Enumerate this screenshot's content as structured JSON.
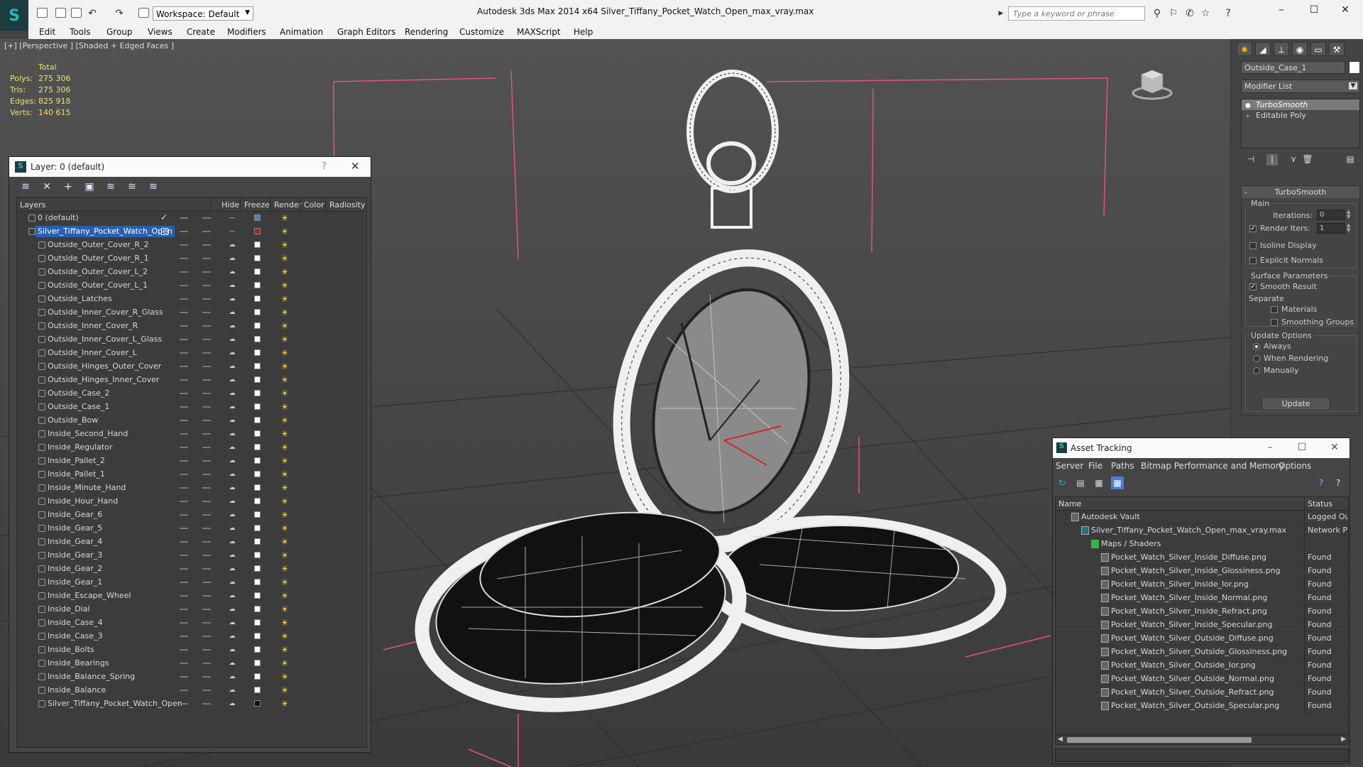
{
  "titlebar": {
    "workspace": "Workspace: Default",
    "window_title": "Autodesk 3ds Max  2014 x64      Silver_Tiffany_Pocket_Watch_Open_max_vray.max",
    "search_placeholder": "Type a keyword or phrase"
  },
  "menu": [
    "Edit",
    "Tools",
    "Group",
    "Views",
    "Create",
    "Modifiers",
    "Animation",
    "Graph Editors",
    "Rendering",
    "Customize",
    "MAXScript",
    "Help"
  ],
  "viewport": {
    "label": "[+] [Perspective ] [Shaded + Edged Faces ]",
    "stats": {
      "total_label": "Total",
      "rows": [
        {
          "label": "Polys:",
          "value": "275 306"
        },
        {
          "label": "Tris:",
          "value": "275 306"
        },
        {
          "label": "Edges:",
          "value": "825 918"
        },
        {
          "label": "Verts:",
          "value": "140 615"
        }
      ]
    }
  },
  "layer_dialog": {
    "title": "Layer: 0 (default)",
    "help": "?",
    "columns": [
      "Layers",
      "Hide",
      "Freeze",
      "Render",
      "Color",
      "Radiosity"
    ],
    "rows": [
      {
        "name": "0 (default)",
        "level": 1,
        "color": "#4a80d0",
        "check": true
      },
      {
        "name": "Silver_Tiffany_Pocket_Watch_Open",
        "level": 1,
        "color": "#b01c1c",
        "selected": true,
        "active": true
      },
      {
        "name": "Outside_Outer_Cover_R_2",
        "level": 2,
        "color": "#ffffff"
      },
      {
        "name": "Outside_Outer_Cover_R_1",
        "level": 2,
        "color": "#ffffff"
      },
      {
        "name": "Outside_Outer_Cover_L_2",
        "level": 2,
        "color": "#ffffff"
      },
      {
        "name": "Outside_Outer_Cover_L_1",
        "level": 2,
        "color": "#ffffff"
      },
      {
        "name": "Outside_Latches",
        "level": 2,
        "color": "#ffffff"
      },
      {
        "name": "Outside_Inner_Cover_R_Glass",
        "level": 2,
        "color": "#ffffff"
      },
      {
        "name": "Outside_Inner_Cover_R",
        "level": 2,
        "color": "#ffffff"
      },
      {
        "name": "Outside_Inner_Cover_L_Glass",
        "level": 2,
        "color": "#ffffff"
      },
      {
        "name": "Outside_Inner_Cover_L",
        "level": 2,
        "color": "#ffffff"
      },
      {
        "name": "Outside_Hinges_Outer_Cover",
        "level": 2,
        "color": "#ffffff"
      },
      {
        "name": "Outside_Hinges_Inner_Cover",
        "level": 2,
        "color": "#ffffff"
      },
      {
        "name": "Outside_Case_2",
        "level": 2,
        "color": "#ffffff"
      },
      {
        "name": "Outside_Case_1",
        "level": 2,
        "color": "#ffffff"
      },
      {
        "name": "Outside_Bow",
        "level": 2,
        "color": "#ffffff"
      },
      {
        "name": "Inside_Second_Hand",
        "level": 2,
        "color": "#ffffff"
      },
      {
        "name": "Inside_Regulator",
        "level": 2,
        "color": "#ffffff"
      },
      {
        "name": "Inside_Pallet_2",
        "level": 2,
        "color": "#ffffff"
      },
      {
        "name": "Inside_Pallet_1",
        "level": 2,
        "color": "#ffffff"
      },
      {
        "name": "Inside_Minute_Hand",
        "level": 2,
        "color": "#ffffff"
      },
      {
        "name": "Inside_Hour_Hand",
        "level": 2,
        "color": "#ffffff"
      },
      {
        "name": "Inside_Gear_6",
        "level": 2,
        "color": "#ffffff"
      },
      {
        "name": "Inside_Gear_5",
        "level": 2,
        "color": "#ffffff"
      },
      {
        "name": "Inside_Gear_4",
        "level": 2,
        "color": "#ffffff"
      },
      {
        "name": "Inside_Gear_3",
        "level": 2,
        "color": "#ffffff"
      },
      {
        "name": "Inside_Gear_2",
        "level": 2,
        "color": "#ffffff"
      },
      {
        "name": "Inside_Gear_1",
        "level": 2,
        "color": "#ffffff"
      },
      {
        "name": "Inside_Escape_Wheel",
        "level": 2,
        "color": "#ffffff"
      },
      {
        "name": "Inside_Dial",
        "level": 2,
        "color": "#ffffff"
      },
      {
        "name": "Inside_Case_4",
        "level": 2,
        "color": "#ffffff"
      },
      {
        "name": "Inside_Case_3",
        "level": 2,
        "color": "#ffffff"
      },
      {
        "name": "Inside_Bolts",
        "level": 2,
        "color": "#ffffff"
      },
      {
        "name": "Inside_Bearings",
        "level": 2,
        "color": "#ffffff"
      },
      {
        "name": "Inside_Balance_Spring",
        "level": 2,
        "color": "#ffffff"
      },
      {
        "name": "Inside_Balance",
        "level": 2,
        "color": "#ffffff"
      },
      {
        "name": "Silver_Tiffany_Pocket_Watch_Open",
        "level": 2,
        "color": "#111111"
      }
    ]
  },
  "command_panel": {
    "object_name": "Outside_Case_1",
    "modifier_list": "Modifier List",
    "stack": [
      {
        "name": "TurboSmooth",
        "selected": true
      },
      {
        "name": "Editable Poly",
        "selected": false
      }
    ],
    "rollout_title": "TurboSmooth",
    "main_group": "Main",
    "iterations_label": "Iterations:",
    "iterations_value": "0",
    "render_iters_label": "Render Iters:",
    "render_iters_value": "1",
    "isoline_label": "Isoline Display",
    "explicit_normals_label": "Explicit Normals",
    "surface_group": "Surface Parameters",
    "smooth_result_label": "Smooth Result",
    "separate_label": "Separate",
    "materials_label": "Materials",
    "smoothing_groups_label": "Smoothing Groups",
    "update_group": "Update Options",
    "always_label": "Always",
    "when_rendering_label": "When Rendering",
    "manually_label": "Manually",
    "update_button": "Update"
  },
  "asset_tracking": {
    "title": "Asset Tracking",
    "menu": [
      "Server",
      "File",
      "Paths",
      "Bitmap Performance and Memory",
      "Options"
    ],
    "columns": [
      "Name",
      "Status"
    ],
    "rows": [
      {
        "name": "Autodesk Vault",
        "status": "Logged Ou",
        "level": 1
      },
      {
        "name": "Silver_Tiffany_Pocket_Watch_Open_max_vray.max",
        "status": "Network P",
        "level": 2
      },
      {
        "name": "Maps / Shaders",
        "status": "",
        "level": 3
      },
      {
        "name": "Pocket_Watch_Silver_Inside_Diffuse.png",
        "status": "Found",
        "level": 4
      },
      {
        "name": "Pocket_Watch_Silver_Inside_Glossiness.png",
        "status": "Found",
        "level": 4
      },
      {
        "name": "Pocket_Watch_Silver_Inside_Ior.png",
        "status": "Found",
        "level": 4
      },
      {
        "name": "Pocket_Watch_Silver_Inside_Normal.png",
        "status": "Found",
        "level": 4
      },
      {
        "name": "Pocket_Watch_Silver_Inside_Refract.png",
        "status": "Found",
        "level": 4
      },
      {
        "name": "Pocket_Watch_Silver_Inside_Specular.png",
        "status": "Found",
        "level": 4
      },
      {
        "name": "Pocket_Watch_Silver_Outside_Diffuse.png",
        "status": "Found",
        "level": 4
      },
      {
        "name": "Pocket_Watch_Silver_Outside_Glossiness.png",
        "status": "Found",
        "level": 4
      },
      {
        "name": "Pocket_Watch_Silver_Outside_Ior.png",
        "status": "Found",
        "level": 4
      },
      {
        "name": "Pocket_Watch_Silver_Outside_Normal.png",
        "status": "Found",
        "level": 4
      },
      {
        "name": "Pocket_Watch_Silver_Outside_Refract.png",
        "status": "Found",
        "level": 4
      },
      {
        "name": "Pocket_Watch_Silver_Outside_Specular.png",
        "status": "Found",
        "level": 4
      }
    ]
  }
}
